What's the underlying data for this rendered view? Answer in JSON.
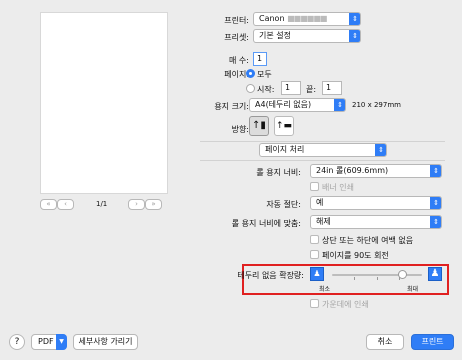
{
  "printer": {
    "label": "프린터:",
    "value": "Canon",
    "model_blurred": "■■■■■■"
  },
  "preset": {
    "label": "프리셋:",
    "value": "기본 설정"
  },
  "copies": {
    "label": "매 수:",
    "value": "1"
  },
  "pages": {
    "label": "페이지:",
    "all": "모두",
    "from_label": "시작:",
    "from_value": "1",
    "to_label": "끝:",
    "to_value": "1"
  },
  "paper_size": {
    "label": "용지 크기:",
    "value": "A4(테두리 없음)",
    "dimensions": "210 x 297mm"
  },
  "orientation": {
    "label": "방향:"
  },
  "preview": {
    "page_indicator": "1/1"
  },
  "section": {
    "value": "페이지 처리"
  },
  "roll_width": {
    "label": "롤 용지 너비:",
    "value": "24in 롤(609.6mm)"
  },
  "banner": {
    "label": "배너 인쇄"
  },
  "auto_cut": {
    "label": "자동 절단:",
    "value": "예"
  },
  "fit_roll": {
    "label": "롤 용지 너비에 맞춤:",
    "value": "해제"
  },
  "options": {
    "top_bottom_margin": "상단 또는 하단에 여백 없음",
    "rotate_90": "페이지를 90도 회전"
  },
  "borderless": {
    "label": "테두리 없음 확장량:",
    "min_label": "최소",
    "max_label": "최대",
    "slider_fraction": 0.78,
    "highlight_color": "#e02020"
  },
  "center_print": {
    "label": "가운데에 인쇄"
  },
  "footer": {
    "help": "?",
    "pdf": "PDF",
    "hide_details": "세부사항 가리기",
    "cancel": "취소",
    "print": "프린트"
  },
  "colors": {
    "accent": "#2f7df6"
  }
}
